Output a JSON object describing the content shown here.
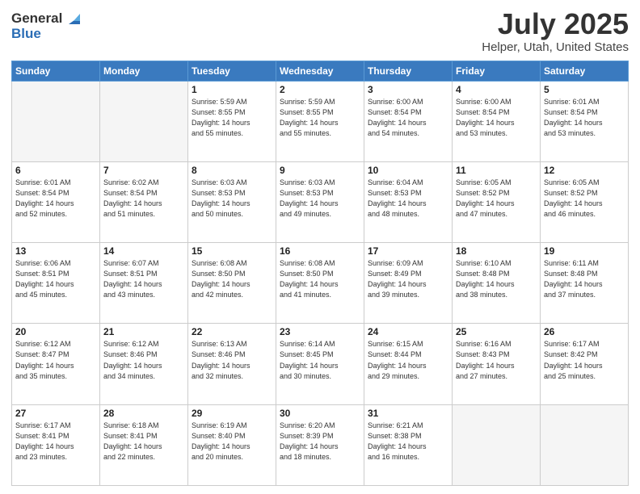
{
  "logo": {
    "general": "General",
    "blue": "Blue"
  },
  "header": {
    "title": "July 2025",
    "subtitle": "Helper, Utah, United States"
  },
  "weekdays": [
    "Sunday",
    "Monday",
    "Tuesday",
    "Wednesday",
    "Thursday",
    "Friday",
    "Saturday"
  ],
  "weeks": [
    [
      {
        "num": "",
        "info": ""
      },
      {
        "num": "",
        "info": ""
      },
      {
        "num": "1",
        "info": "Sunrise: 5:59 AM\nSunset: 8:55 PM\nDaylight: 14 hours\nand 55 minutes."
      },
      {
        "num": "2",
        "info": "Sunrise: 5:59 AM\nSunset: 8:55 PM\nDaylight: 14 hours\nand 55 minutes."
      },
      {
        "num": "3",
        "info": "Sunrise: 6:00 AM\nSunset: 8:54 PM\nDaylight: 14 hours\nand 54 minutes."
      },
      {
        "num": "4",
        "info": "Sunrise: 6:00 AM\nSunset: 8:54 PM\nDaylight: 14 hours\nand 53 minutes."
      },
      {
        "num": "5",
        "info": "Sunrise: 6:01 AM\nSunset: 8:54 PM\nDaylight: 14 hours\nand 53 minutes."
      }
    ],
    [
      {
        "num": "6",
        "info": "Sunrise: 6:01 AM\nSunset: 8:54 PM\nDaylight: 14 hours\nand 52 minutes."
      },
      {
        "num": "7",
        "info": "Sunrise: 6:02 AM\nSunset: 8:54 PM\nDaylight: 14 hours\nand 51 minutes."
      },
      {
        "num": "8",
        "info": "Sunrise: 6:03 AM\nSunset: 8:53 PM\nDaylight: 14 hours\nand 50 minutes."
      },
      {
        "num": "9",
        "info": "Sunrise: 6:03 AM\nSunset: 8:53 PM\nDaylight: 14 hours\nand 49 minutes."
      },
      {
        "num": "10",
        "info": "Sunrise: 6:04 AM\nSunset: 8:53 PM\nDaylight: 14 hours\nand 48 minutes."
      },
      {
        "num": "11",
        "info": "Sunrise: 6:05 AM\nSunset: 8:52 PM\nDaylight: 14 hours\nand 47 minutes."
      },
      {
        "num": "12",
        "info": "Sunrise: 6:05 AM\nSunset: 8:52 PM\nDaylight: 14 hours\nand 46 minutes."
      }
    ],
    [
      {
        "num": "13",
        "info": "Sunrise: 6:06 AM\nSunset: 8:51 PM\nDaylight: 14 hours\nand 45 minutes."
      },
      {
        "num": "14",
        "info": "Sunrise: 6:07 AM\nSunset: 8:51 PM\nDaylight: 14 hours\nand 43 minutes."
      },
      {
        "num": "15",
        "info": "Sunrise: 6:08 AM\nSunset: 8:50 PM\nDaylight: 14 hours\nand 42 minutes."
      },
      {
        "num": "16",
        "info": "Sunrise: 6:08 AM\nSunset: 8:50 PM\nDaylight: 14 hours\nand 41 minutes."
      },
      {
        "num": "17",
        "info": "Sunrise: 6:09 AM\nSunset: 8:49 PM\nDaylight: 14 hours\nand 39 minutes."
      },
      {
        "num": "18",
        "info": "Sunrise: 6:10 AM\nSunset: 8:48 PM\nDaylight: 14 hours\nand 38 minutes."
      },
      {
        "num": "19",
        "info": "Sunrise: 6:11 AM\nSunset: 8:48 PM\nDaylight: 14 hours\nand 37 minutes."
      }
    ],
    [
      {
        "num": "20",
        "info": "Sunrise: 6:12 AM\nSunset: 8:47 PM\nDaylight: 14 hours\nand 35 minutes."
      },
      {
        "num": "21",
        "info": "Sunrise: 6:12 AM\nSunset: 8:46 PM\nDaylight: 14 hours\nand 34 minutes."
      },
      {
        "num": "22",
        "info": "Sunrise: 6:13 AM\nSunset: 8:46 PM\nDaylight: 14 hours\nand 32 minutes."
      },
      {
        "num": "23",
        "info": "Sunrise: 6:14 AM\nSunset: 8:45 PM\nDaylight: 14 hours\nand 30 minutes."
      },
      {
        "num": "24",
        "info": "Sunrise: 6:15 AM\nSunset: 8:44 PM\nDaylight: 14 hours\nand 29 minutes."
      },
      {
        "num": "25",
        "info": "Sunrise: 6:16 AM\nSunset: 8:43 PM\nDaylight: 14 hours\nand 27 minutes."
      },
      {
        "num": "26",
        "info": "Sunrise: 6:17 AM\nSunset: 8:42 PM\nDaylight: 14 hours\nand 25 minutes."
      }
    ],
    [
      {
        "num": "27",
        "info": "Sunrise: 6:17 AM\nSunset: 8:41 PM\nDaylight: 14 hours\nand 23 minutes."
      },
      {
        "num": "28",
        "info": "Sunrise: 6:18 AM\nSunset: 8:41 PM\nDaylight: 14 hours\nand 22 minutes."
      },
      {
        "num": "29",
        "info": "Sunrise: 6:19 AM\nSunset: 8:40 PM\nDaylight: 14 hours\nand 20 minutes."
      },
      {
        "num": "30",
        "info": "Sunrise: 6:20 AM\nSunset: 8:39 PM\nDaylight: 14 hours\nand 18 minutes."
      },
      {
        "num": "31",
        "info": "Sunrise: 6:21 AM\nSunset: 8:38 PM\nDaylight: 14 hours\nand 16 minutes."
      },
      {
        "num": "",
        "info": ""
      },
      {
        "num": "",
        "info": ""
      }
    ]
  ]
}
